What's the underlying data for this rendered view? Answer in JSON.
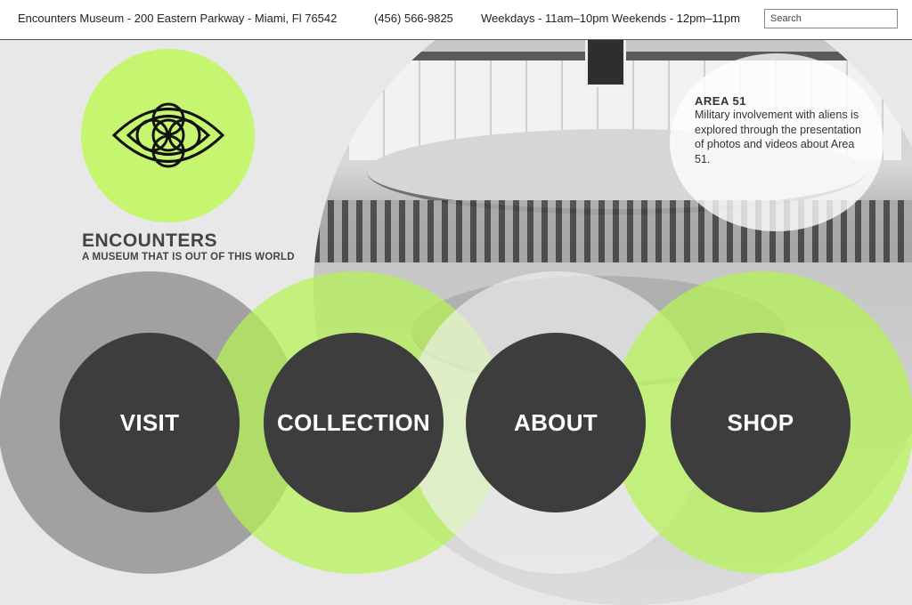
{
  "header": {
    "address": "Encounters Museum - 200 Eastern Parkway - Miami, Fl 76542",
    "phone": "(456) 566-9825",
    "hours": "Weekdays - 11am–10pm Weekends - 12pm–11pm",
    "search_placeholder": "Search"
  },
  "brand": {
    "name": "ENCOUNTERS",
    "tagline": "A MUSEUM THAT IS OUT OF THIS WORLD",
    "logo_icon": "alien-eye-icon"
  },
  "feature": {
    "title": "AREA 51",
    "text": "Military involvement with aliens is explored through the presentation of photos and videos about Area 51."
  },
  "nav": {
    "items": [
      {
        "label": "VISIT"
      },
      {
        "label": "COLLECTION"
      },
      {
        "label": "ABOUT"
      },
      {
        "label": "SHOP"
      }
    ]
  },
  "colors": {
    "accent_green": "#c6f570",
    "nav_dark": "#3d3d3d",
    "ring_grey": "#969696"
  }
}
